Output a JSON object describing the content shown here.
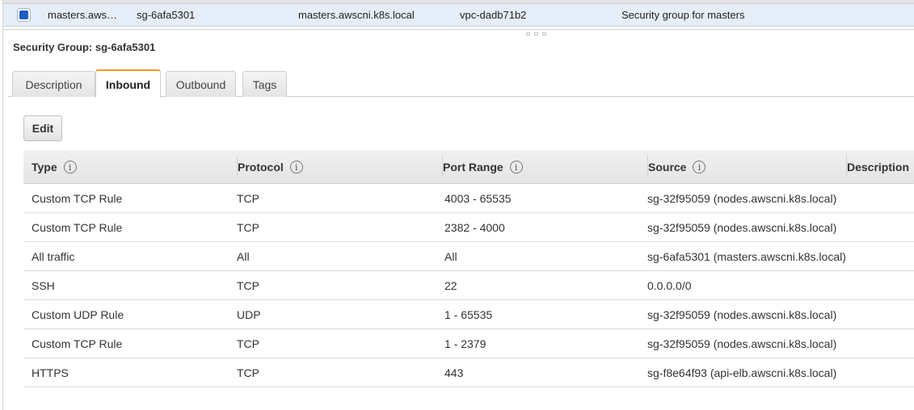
{
  "selected_row": {
    "checked": true,
    "name": "masters.aws…",
    "group_id": "sg-6afa5301",
    "group_name": "masters.awscni.k8s.local",
    "vpc_id": "vpc-dadb71b2",
    "description": "Security group for masters"
  },
  "details": {
    "title": "Security Group: sg-6afa5301"
  },
  "tabs": [
    {
      "label": "Description",
      "active": false
    },
    {
      "label": "Inbound",
      "active": true
    },
    {
      "label": "Outbound",
      "active": false
    },
    {
      "label": "Tags",
      "active": false
    }
  ],
  "toolbar": {
    "edit_label": "Edit"
  },
  "table": {
    "info_glyph": "i",
    "columns": [
      "Type",
      "Protocol",
      "Port Range",
      "Source",
      "Description"
    ],
    "rows": [
      [
        "Custom TCP Rule",
        "TCP",
        "4003 - 65535",
        "sg-32f95059 (nodes.awscni.k8s.local)"
      ],
      [
        "Custom TCP Rule",
        "TCP",
        "2382 - 4000",
        "sg-32f95059 (nodes.awscni.k8s.local)"
      ],
      [
        "All traffic",
        "All",
        "All",
        "sg-6afa5301 (masters.awscni.k8s.local)"
      ],
      [
        "SSH",
        "TCP",
        "22",
        "0.0.0.0/0"
      ],
      [
        "Custom UDP Rule",
        "UDP",
        "1 - 65535",
        "sg-32f95059 (nodes.awscni.k8s.local)"
      ],
      [
        "Custom TCP Rule",
        "TCP",
        "1 - 2379",
        "sg-32f95059 (nodes.awscni.k8s.local)"
      ],
      [
        "HTTPS",
        "TCP",
        "443",
        "sg-f8e64f93 (api-elb.awscni.k8s.local)"
      ]
    ]
  },
  "colors": {
    "active_tab_accent": "#f7961c",
    "checkbox_fill": "#1f5fc0",
    "selected_row_bg": "#e6eef9"
  }
}
